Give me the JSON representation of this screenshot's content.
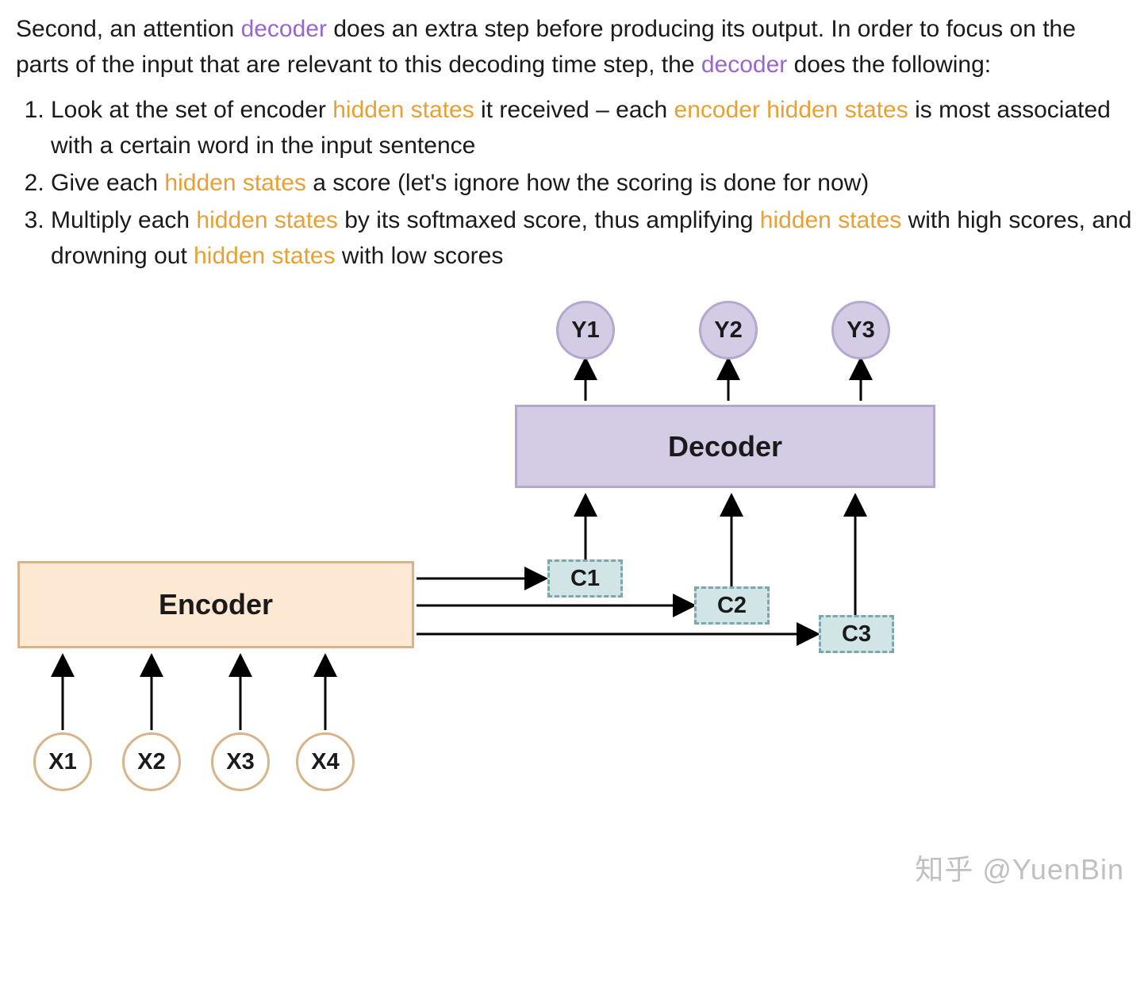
{
  "intro": {
    "pre1": "Second, an attention ",
    "decoder1": "decoder",
    "post1": " does an extra step before producing its output. In order to focus on the parts of the input that are relevant to this decoding time step, the ",
    "decoder2": "decoder",
    "post2": " does the following:"
  },
  "steps": {
    "s1a": "Look at the set of encoder ",
    "s1h1": "hidden states",
    "s1b": " it received – each ",
    "s1h2": "encoder hidden states",
    "s1c": " is most associated with a certain word in the input sentence",
    "s2a": "Give each ",
    "s2h1": "hidden states",
    "s2b": " a score (let's ignore how the scoring is done for now)",
    "s3a": "Multiply each ",
    "s3h1": "hidden states",
    "s3b": " by its softmaxed score, thus amplifying ",
    "s3h2": "hidden states",
    "s3c": " with high scores, and drowning out ",
    "s3h3": "hidden states",
    "s3d": " with low scores"
  },
  "diagram": {
    "encoder": "Encoder",
    "decoder": "Decoder",
    "x1": "X1",
    "x2": "X2",
    "x3": "X3",
    "x4": "X4",
    "y1": "Y1",
    "y2": "Y2",
    "y3": "Y3",
    "c1": "C1",
    "c2": "C2",
    "c3": "C3"
  },
  "watermark": "知乎 @YuenBin"
}
